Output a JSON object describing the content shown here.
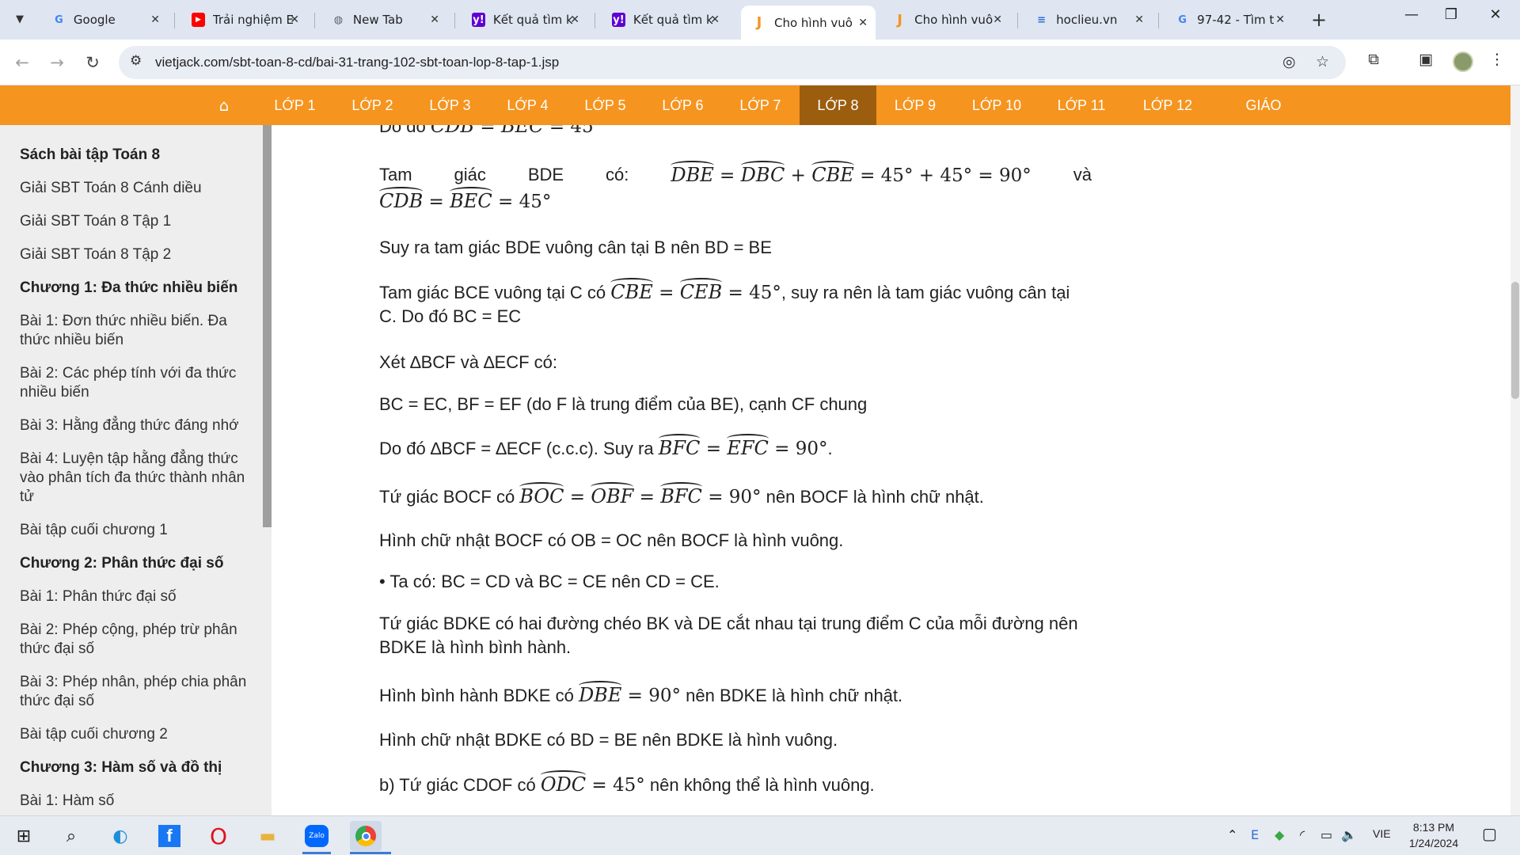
{
  "browser": {
    "tabs": [
      {
        "title": "Google",
        "icon": "google-icon",
        "color": "#4285f4"
      },
      {
        "title": "Trải nghiệm E",
        "icon": "youtube-icon",
        "color": "#ff0000"
      },
      {
        "title": "New Tab",
        "icon": "chrome-newtab-icon",
        "color": "#5f6368"
      },
      {
        "title": "Kết quả tìm k",
        "icon": "yahoo-icon",
        "color": "#6001d2"
      },
      {
        "title": "Kết quả tìm k",
        "icon": "yahoo-icon",
        "color": "#6001d2"
      },
      {
        "title": "Cho hình vuô",
        "icon": "vietjack-icon",
        "color": "#f5941e",
        "active": true
      },
      {
        "title": "Cho hình vuô",
        "icon": "vietjack-icon",
        "color": "#f5941e"
      },
      {
        "title": "hoclieu.vn",
        "icon": "hoclieu-icon",
        "color": "#2f6fd6"
      },
      {
        "title": "97-42 - Tìm t",
        "icon": "google-icon",
        "color": "#4285f4"
      }
    ],
    "url": "vietjack.com/sbt-toan-8-cd/bai-31-trang-102-sbt-toan-lop-8-tap-1.jsp"
  },
  "sitenav": {
    "items": [
      "LỚP 1",
      "LỚP 2",
      "LỚP 3",
      "LỚP 4",
      "LỚP 5",
      "LỚP 6",
      "LỚP 7",
      "LỚP 8",
      "LỚP 9",
      "LỚP 10",
      "LỚP 11",
      "LỚP 12",
      "GIÁO VIÊN"
    ],
    "active": "LỚP 8"
  },
  "sidebar": {
    "items": [
      {
        "label": "Sách bài tập Toán 8",
        "head": true
      },
      {
        "label": "Giải SBT Toán 8 Cánh diều"
      },
      {
        "label": "Giải SBT Toán 8 Tập 1"
      },
      {
        "label": "Giải SBT Toán 8 Tập 2"
      },
      {
        "label": "Chương 1: Đa thức nhiều biến",
        "head": true
      },
      {
        "label": "Bài 1: Đơn thức nhiều biến. Đa thức nhiều biến"
      },
      {
        "label": "Bài 2: Các phép tính với đa thức nhiều biến"
      },
      {
        "label": "Bài 3: Hằng đẳng thức đáng nhớ"
      },
      {
        "label": "Bài 4: Luyện tập hằng đẳng thức vào phân tích đa thức thành nhân tử"
      },
      {
        "label": "Bài tập cuối chương 1"
      },
      {
        "label": "Chương 2: Phân thức đại số",
        "head": true
      },
      {
        "label": "Bài 1: Phân thức đại số"
      },
      {
        "label": "Bài 2: Phép cộng, phép trừ phân thức đại số"
      },
      {
        "label": "Bài 3: Phép nhân, phép chia phân thức đại số"
      },
      {
        "label": "Bài tập cuối chương 2"
      },
      {
        "label": "Chương 3: Hàm số và đồ thị",
        "head": true
      },
      {
        "label": "Bài 1: Hàm số"
      }
    ]
  },
  "content": {
    "p0": {
      "t1": "Do đó ",
      "a1": "CDB",
      "t2": " = ",
      "a2": "BEC",
      "t3": " = 45"
    },
    "p1": {
      "w1": "Tam",
      "w2": "giác",
      "w3": "BDE",
      "w4": "có:",
      "a1": "DBE",
      "eq1": " = ",
      "a2": "DBC",
      "plus": " + ",
      "a3": "CBE",
      "eq2": " = 45° + 45° = 90°",
      "w5": "và",
      "a4": "CDB",
      "eq3": " = ",
      "a5": "BEC",
      "eq4": " = 45°"
    },
    "p2": "Suy ra tam giác BDE vuông cân tại B nên BD = BE",
    "p3": {
      "t1": "Tam giác BCE vuông tại C có ",
      "a1": "CBE",
      "eq1": " = ",
      "a2": "CEB",
      "eq2": " = 45°",
      "t2": ", suy ra nên là tam giác vuông cân tại C. Do đó BC = EC"
    },
    "p4": "Xét ∆BCF và ∆ECF có:",
    "p5": "BC = EC, BF = EF (do F là trung điểm của BE), cạnh CF chung",
    "p6": {
      "t1": "Do đó ∆BCF = ∆ECF  (c.c.c). Suy ra ",
      "a1": "BFC",
      "eq1": " = ",
      "a2": "EFC",
      "eq2": " = 90°",
      "t2": "."
    },
    "p7": {
      "t1": "Tứ giác BOCF có ",
      "a1": "BOC",
      "eq1": " = ",
      "a2": "OBF",
      "eq2": " = ",
      "a3": "BFC",
      "eq3": " = 90°",
      "t2": " nên BOCF là hình chữ nhật."
    },
    "p8": "Hình chữ nhật BOCF có OB = OC nên BOCF là hình vuông.",
    "p9": "• Ta có: BC = CD và BC = CE nên CD = CE.",
    "p10": "Tứ giác BDKE có hai đường chéo BK và DE cắt nhau tại trung điểm C của mỗi đường nên BDKE là hình bình hành.",
    "p11": {
      "t1": "Hình bình hành BDKE có ",
      "a1": "DBE",
      "eq1": " = 90°",
      "t2": " nên BDKE là hình chữ nhật."
    },
    "p12": "Hình chữ nhật BDKE có BD = BE nên BDKE là hình vuông.",
    "p13": {
      "t1": "b) Tứ giác CDOF có ",
      "a1": "ODC",
      "eq1": " = 45°",
      "t2": " nên không thể là hình vuông."
    }
  },
  "taskbar": {
    "apps": [
      "windows-start-icon",
      "search-icon",
      "edge-icon",
      "facebook-icon",
      "opera-icon",
      "file-explorer-icon",
      "zalo-icon",
      "chrome-icon"
    ],
    "zalo_label": "Zalo",
    "language": "VIE",
    "time": "8:13 PM",
    "date": "1/24/2024"
  }
}
